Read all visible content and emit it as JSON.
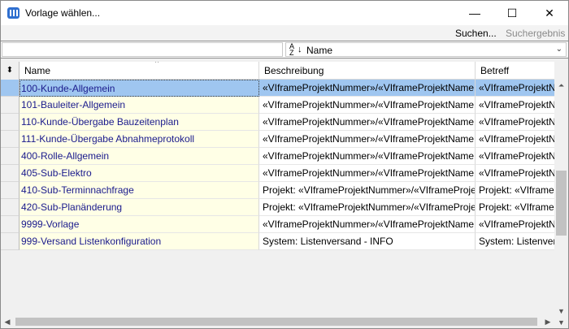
{
  "window": {
    "title": "Vorlage wählen...",
    "minimize": "—",
    "maximize": "☐",
    "close": "✕"
  },
  "toolbar": {
    "search_label": "Suchen...",
    "result_label": "Suchergebnis"
  },
  "filter": {
    "value": "",
    "sort_label": "Name",
    "sort_icon_top": "A",
    "sort_icon_bottom": "Z",
    "sort_arrow": "↓",
    "chevron": "⌄"
  },
  "grid": {
    "selector_glyph": "⬍",
    "sort_indicator": "^",
    "columns": [
      "Name",
      "Beschreibung",
      "Betreff"
    ],
    "rows": [
      {
        "name": "100-Kunde-Allgemein",
        "description": "«VIframeProjektNummer»/«VIframeProjektName",
        "subject": "«VIframeProjektN",
        "selected": true
      },
      {
        "name": "101-Bauleiter-Allgemein",
        "description": "«VIframeProjektNummer»/«VIframeProjektName",
        "subject": "«VIframeProjektN"
      },
      {
        "name": "110-Kunde-Übergabe Bauzeitenplan",
        "description": "«VIframeProjektNummer»/«VIframeProjektName",
        "subject": "«VIframeProjektN"
      },
      {
        "name": "111-Kunde-Übergabe Abnahmeprotokoll",
        "description": "«VIframeProjektNummer»/«VIframeProjektName",
        "subject": "«VIframeProjektN"
      },
      {
        "name": "400-Rolle-Allgemein",
        "description": "«VIframeProjektNummer»/«VIframeProjektName",
        "subject": "«VIframeProjektN"
      },
      {
        "name": "405-Sub-Elektro",
        "description": "«VIframeProjektNummer»/«VIframeProjektName",
        "subject": "«VIframeProjektN"
      },
      {
        "name": "410-Sub-Terminnachfrage",
        "description": "Projekt: «VIframeProjektNummer»/«VIframeProje",
        "subject": "Projekt: «VIframel"
      },
      {
        "name": "420-Sub-Planänderung",
        "description": "Projekt: «VIframeProjektNummer»/«VIframeProje",
        "subject": "Projekt: «VIframel"
      },
      {
        "name": "9999-Vorlage",
        "description": "«VIframeProjektNummer»/«VIframeProjektName",
        "subject": "«VIframeProjektN"
      },
      {
        "name": "999-Versand Listenkonfiguration",
        "description": "System: Listenversand - INFO",
        "subject": "System: Listenver"
      }
    ]
  },
  "scrollbars": {
    "up": "▲",
    "down": "▼",
    "top": "⏶",
    "left": "◀",
    "right": "▶"
  },
  "colors": {
    "selection": "#9fc6f0",
    "name_column_bg": "#ffffe6",
    "name_text": "#1a1a8c",
    "accent_icon": "#2f6fcf"
  }
}
